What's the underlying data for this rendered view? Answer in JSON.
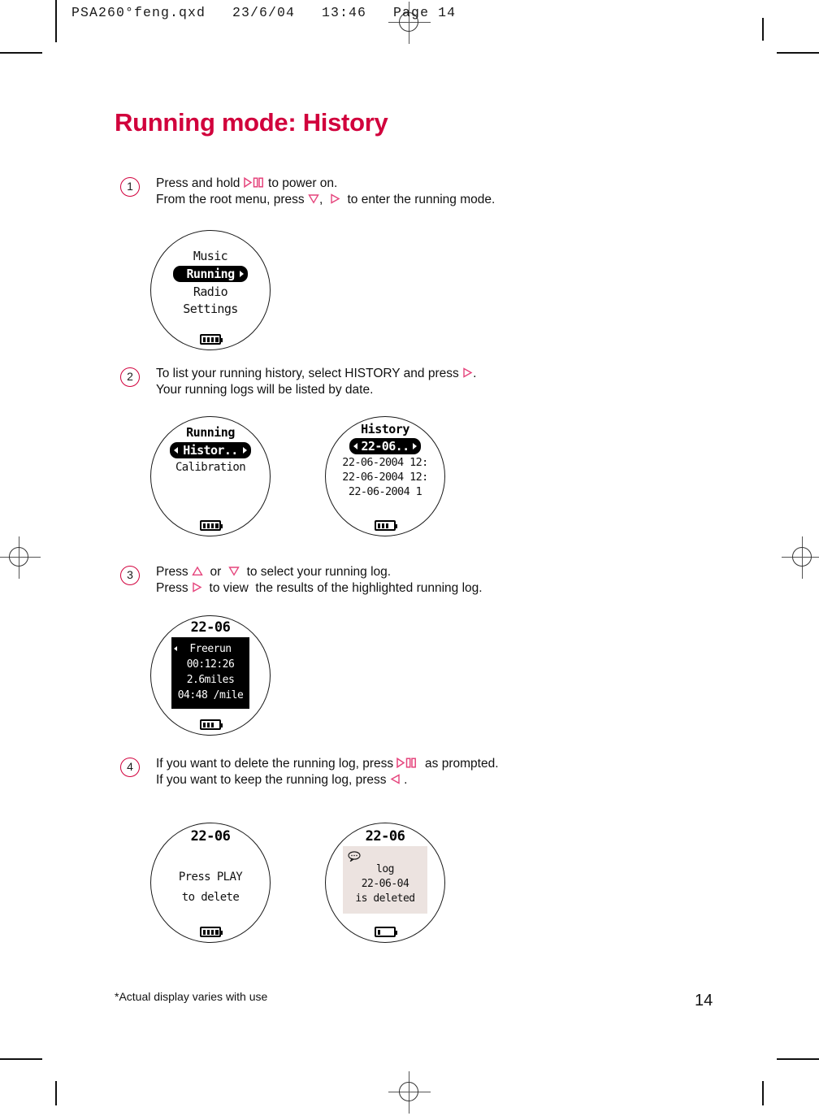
{
  "slug": "PSA260°feng.qxd   23/6/04   13:46   Page 14",
  "title": "Running mode: History",
  "steps": [
    {
      "num": "1",
      "line1_a": "Press and hold ",
      "line1_icon": "play-pause-icon",
      "line1_b": " to power on.",
      "line2_a": "From the root menu, press ",
      "line2_icon1": "triangle-down-icon",
      "line2_mid": ",  ",
      "line2_icon2": "triangle-right-icon",
      "line2_b": "  to enter the running mode."
    },
    {
      "num": "2",
      "line1_a": "To list your running history, select HISTORY and press ",
      "line1_icon": "triangle-right-icon",
      "line1_b": ".",
      "line2_a": "Your running logs will be listed by date.",
      "line2_icon1": "",
      "line2_mid": "",
      "line2_icon2": "",
      "line2_b": ""
    },
    {
      "num": "3",
      "line1_a": "Press ",
      "line1_icon": "triangle-up-icon",
      "line1_b": "  or  ",
      "line1_icon2": "triangle-down-icon",
      "line1_c": "  to select your running log.",
      "line2_a": "Press ",
      "line2_icon1": "triangle-right-icon",
      "line2_b": "  to view  the results of the highlighted running log."
    },
    {
      "num": "4",
      "line1_a": "If you want to delete the running log, press ",
      "line1_icon": "play-pause-icon",
      "line1_b": "  as prompted.",
      "line2_a": "If you want to keep the running log, press ",
      "line2_icon1": "triangle-left-icon",
      "line2_b": " ."
    }
  ],
  "screens": {
    "root_menu": {
      "items": [
        "Music",
        "Running",
        "Radio",
        "Settings"
      ],
      "selected": "Running",
      "battery_cells": 4
    },
    "running_menu": {
      "title": "Running",
      "selected": "Histor..",
      "items": [
        "Calibration"
      ],
      "battery_cells": 4
    },
    "history_list": {
      "title": "History",
      "selected": "22-06..",
      "items": [
        "22-06-2004 12:",
        "22-06-2004 12:",
        "22-06-2004 1"
      ],
      "battery_cells": 3
    },
    "log_detail": {
      "title": "22-06",
      "lines": [
        "Freerun",
        "00:12:26",
        "2.6miles",
        "04:48 /mile"
      ],
      "battery_cells": 3
    },
    "delete_prompt": {
      "title": "22-06",
      "lines": [
        "Press PLAY",
        "to delete"
      ],
      "battery_cells": 4
    },
    "deleted_confirm": {
      "title": "22-06",
      "lines": [
        "log",
        "22-06-04",
        "is deleted"
      ],
      "battery_cells": 1
    }
  },
  "footnote": "*Actual display varies with use",
  "page_number": "14",
  "colors": {
    "title": "#d1003c",
    "key_glyph": "#e5447c",
    "screen_panel_grey": "#ece3e0"
  }
}
